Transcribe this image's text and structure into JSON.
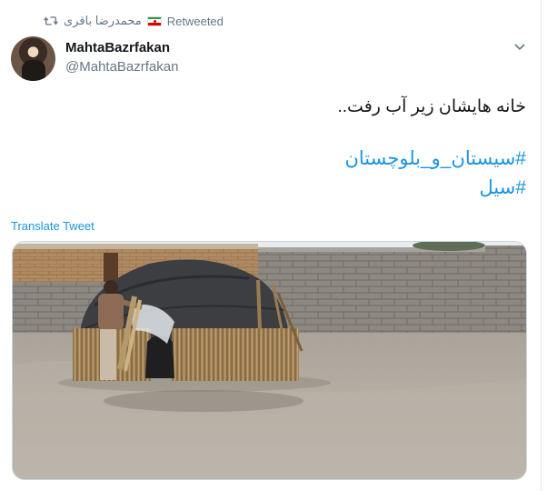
{
  "retweet": {
    "icon": "retweet-icon",
    "retweeter_name": "محمدرضا باقری",
    "flag": "iran-flag-icon",
    "label": "Retweeted"
  },
  "author": {
    "name": "MahtaBazrfakan",
    "handle": "@MahtaBazrfakan",
    "avatar": "avatar-image"
  },
  "menu_icon": "chevron-down-icon",
  "tweet": {
    "text": "خانه هایشان زیر آب رفت..",
    "hashtags": [
      "#سیستان_و_بلوچستان",
      "#سیل"
    ]
  },
  "translate_label": "Translate Tweet",
  "media": {
    "kind": "photo",
    "alt_scene": "flooded-hut-photo"
  },
  "colors": {
    "link": "#1b95e0",
    "secondary_text": "#657786",
    "primary_text": "#14171a"
  }
}
